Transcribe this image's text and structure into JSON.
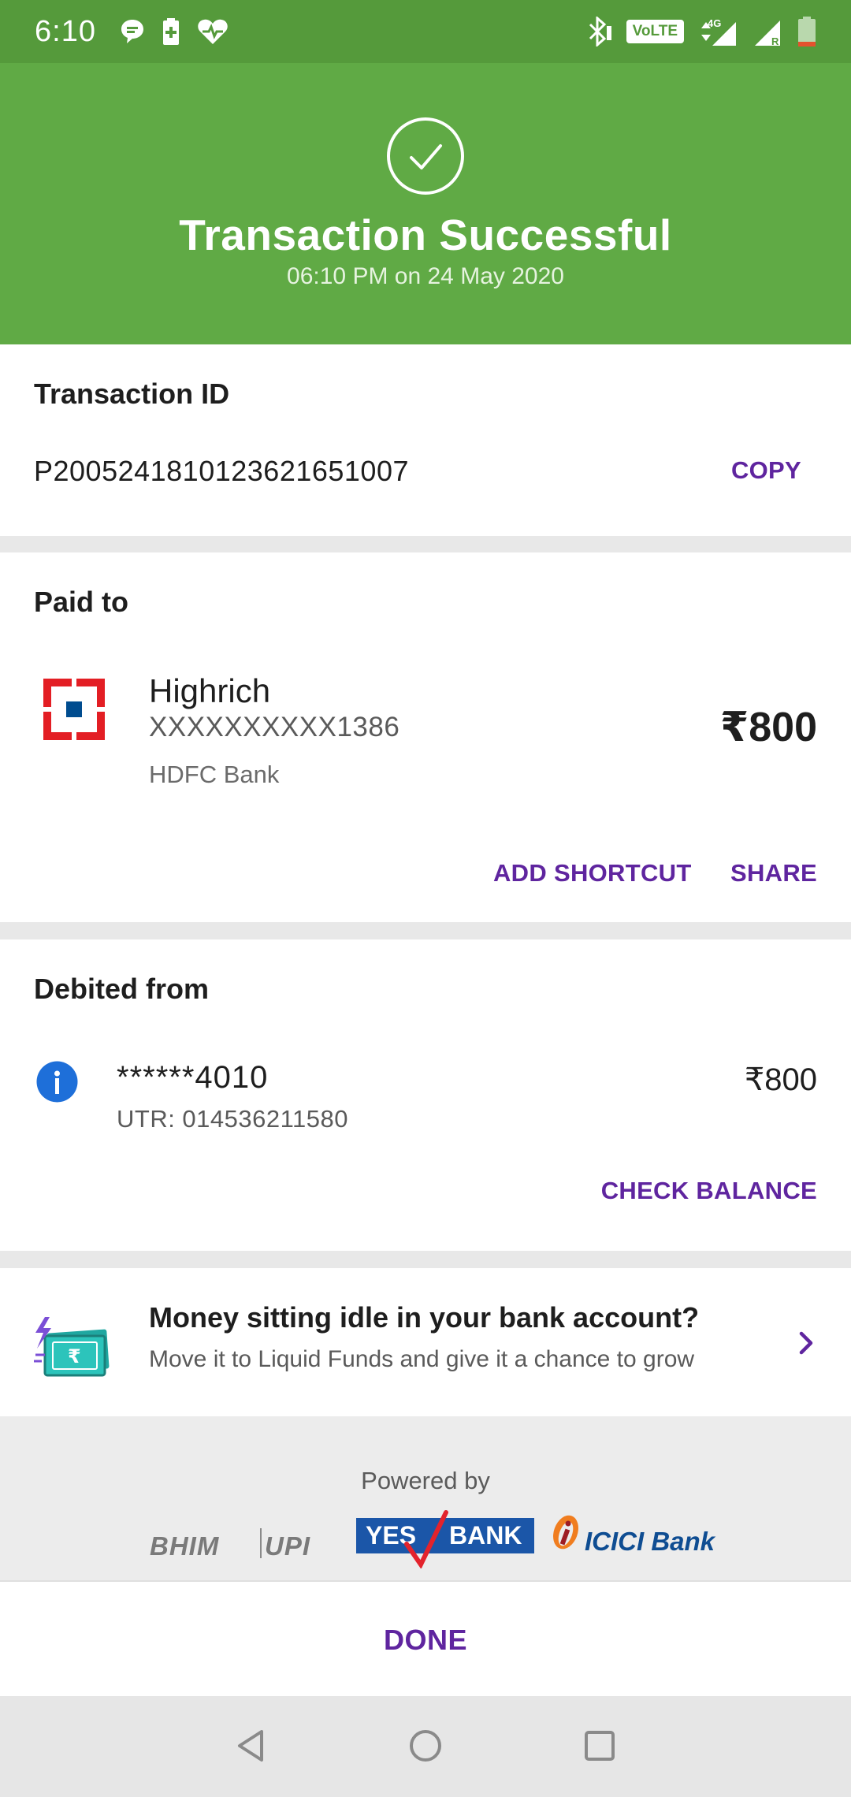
{
  "status_bar": {
    "time": "6:10",
    "volte": "VoLTE",
    "network": "4G",
    "roaming": "R",
    "icons": [
      "chat-bubble-icon",
      "battery-saver-icon",
      "heart-icon",
      "bluetooth-icon",
      "volte-icon",
      "signal-icon",
      "signal-icon",
      "battery-icon"
    ]
  },
  "header": {
    "title": "Transaction Successful",
    "timestamp": "06:10 PM on 24 May 2020",
    "icon": "check-circle-icon",
    "color": "#60aa45"
  },
  "transaction": {
    "label": "Transaction ID",
    "id": "P2005241810123621651007",
    "copy_label": "COPY"
  },
  "paid_to": {
    "label": "Paid to",
    "name": "Highrich",
    "account": "XXXXXXXXXX1386",
    "bank": "HDFC Bank",
    "amount": "₹800",
    "add_shortcut_label": "ADD SHORTCUT",
    "share_label": "SHARE",
    "logo": "hdfc-logo-icon"
  },
  "debited_from": {
    "label": "Debited from",
    "account": "******4010",
    "utr": "UTR: 014536211580",
    "amount": "₹800",
    "check_balance_label": "CHECK BALANCE",
    "icon": "bank-icon"
  },
  "promo": {
    "title": "Money sitting idle in your bank account?",
    "subtitle": "Move it to Liquid Funds and give it a chance to grow",
    "icon": "money-transfer-icon"
  },
  "powered_by": {
    "label": "Powered by",
    "bhim": "BHIM",
    "upi": "UPI",
    "yes_bank_a": "YES",
    "yes_bank_b": "BANK",
    "icici": "ICICI Bank"
  },
  "footer": {
    "done_label": "DONE"
  },
  "colors": {
    "accent": "#5f259f",
    "success": "#60aa45",
    "status_bar": "#559a3b"
  }
}
